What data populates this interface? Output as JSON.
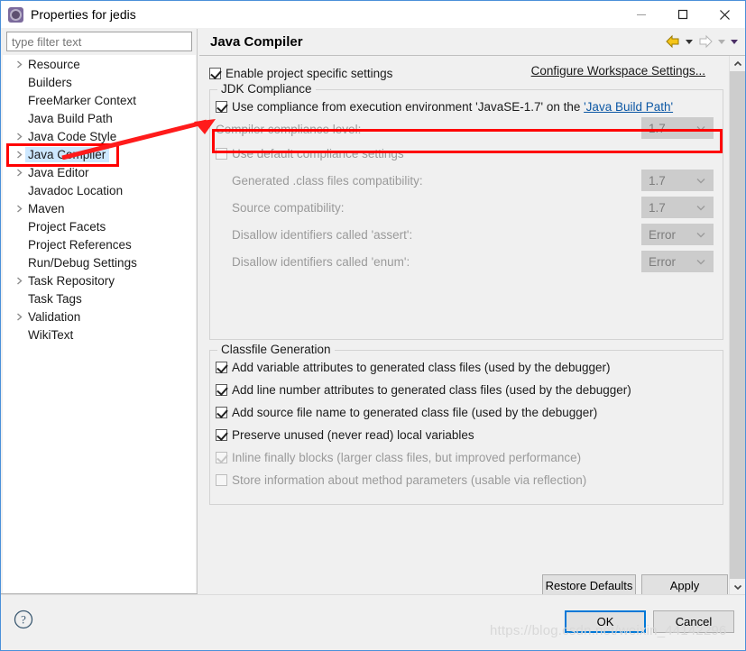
{
  "window": {
    "title": "Properties for jedis",
    "icon": "eclipse-properties-icon",
    "minimize_label": "–",
    "maximize_label": "□",
    "close_label": "✕"
  },
  "sidebar": {
    "filter_placeholder": "type filter text",
    "filter_value": "",
    "items": [
      {
        "label": "Resource",
        "expandable": true,
        "selected": false
      },
      {
        "label": "Builders",
        "expandable": false,
        "selected": false
      },
      {
        "label": "FreeMarker Context",
        "expandable": false,
        "selected": false
      },
      {
        "label": "Java Build Path",
        "expandable": false,
        "selected": false
      },
      {
        "label": "Java Code Style",
        "expandable": true,
        "selected": false
      },
      {
        "label": "Java Compiler",
        "expandable": true,
        "selected": true
      },
      {
        "label": "Java Editor",
        "expandable": true,
        "selected": false
      },
      {
        "label": "Javadoc Location",
        "expandable": false,
        "selected": false
      },
      {
        "label": "Maven",
        "expandable": true,
        "selected": false
      },
      {
        "label": "Project Facets",
        "expandable": false,
        "selected": false
      },
      {
        "label": "Project References",
        "expandable": false,
        "selected": false
      },
      {
        "label": "Run/Debug Settings",
        "expandable": false,
        "selected": false
      },
      {
        "label": "Task Repository",
        "expandable": true,
        "selected": false
      },
      {
        "label": "Task Tags",
        "expandable": false,
        "selected": false
      },
      {
        "label": "Validation",
        "expandable": true,
        "selected": false
      },
      {
        "label": "WikiText",
        "expandable": false,
        "selected": false
      }
    ]
  },
  "page": {
    "title": "Java Compiler",
    "nav": {
      "back_icon": "back-arrow-icon",
      "back_menu_icon": "chevron-down-icon",
      "forward_icon": "forward-arrow-icon",
      "forward_menu_icon": "chevron-down-icon",
      "view_menu_icon": "chevron-down-icon"
    },
    "enable_project_specific": {
      "label": "Enable project specific settings",
      "checked": true
    },
    "configure_workspace_link": "Configure Workspace Settings...",
    "jdk_compliance": {
      "title": "JDK Compliance",
      "use_execution_env": {
        "label_prefix": "Use compliance from execution environment 'JavaSE-1.7' on the ",
        "link": "'Java Build Path'",
        "checked": true
      },
      "compliance_level": {
        "label": "Compiler compliance level:",
        "value": "1.7",
        "disabled": true,
        "highlighted": true
      },
      "use_default_compliance": {
        "label": "Use default compliance settings",
        "checked": false,
        "disabled": true
      },
      "fields": [
        {
          "label": "Generated .class files compatibility:",
          "value": "1.7",
          "disabled": true
        },
        {
          "label": "Source compatibility:",
          "value": "1.7",
          "disabled": true
        },
        {
          "label": "Disallow identifiers called 'assert':",
          "value": "Error",
          "disabled": true
        },
        {
          "label": "Disallow identifiers called 'enum':",
          "value": "Error",
          "disabled": true
        }
      ]
    },
    "classfile_generation": {
      "title": "Classfile Generation",
      "options": [
        {
          "label": "Add variable attributes to generated class files (used by the debugger)",
          "checked": true,
          "disabled": false
        },
        {
          "label": "Add line number attributes to generated class files (used by the debugger)",
          "checked": true,
          "disabled": false
        },
        {
          "label": "Add source file name to generated class file (used by the debugger)",
          "checked": true,
          "disabled": false
        },
        {
          "label": "Preserve unused (never read) local variables",
          "checked": true,
          "disabled": false
        },
        {
          "label": "Inline finally blocks (larger class files, but improved performance)",
          "checked": true,
          "disabled": true
        },
        {
          "label": "Store information about method parameters (usable via reflection)",
          "checked": false,
          "disabled": true
        }
      ]
    },
    "restore_defaults_label": "Restore Defaults",
    "apply_label": "Apply",
    "scrollbar": {
      "up_icon": "chevron-up-icon",
      "down_icon": "chevron-down-icon"
    }
  },
  "footer": {
    "help_icon": "question-mark-help-icon",
    "ok_label": "OK",
    "cancel_label": "Cancel"
  },
  "annotations": {
    "highlight_color": "#ff0000",
    "arrow_name": "red-pointer-arrow"
  },
  "watermark": "https://blog.csdn.net/weixin_44142296"
}
